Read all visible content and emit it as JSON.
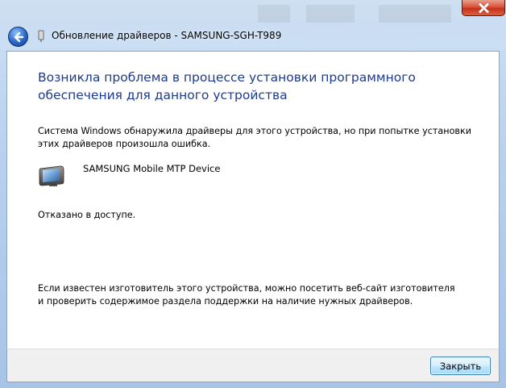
{
  "window": {
    "title": "Обновление драйверов - SAMSUNG-SGH-T989"
  },
  "content": {
    "heading": "Возникла проблема в процессе установки программного обеспечения для данного устройства",
    "description": "Система Windows обнаружила драйверы для этого устройства, но при попытке установки этих драйверов произошла ошибка.",
    "device_name": "SAMSUNG Mobile MTP Device",
    "error_message": "Отказано в доступе.",
    "advice": "Если известен изготовитель этого устройства, можно посетить веб-сайт изготовителя и проверить содержимое раздела поддержки на наличие нужных драйверов."
  },
  "footer": {
    "close_label": "Закрыть"
  },
  "colors": {
    "heading": "#1e3a8c",
    "close_button_red": "#c7301a"
  }
}
